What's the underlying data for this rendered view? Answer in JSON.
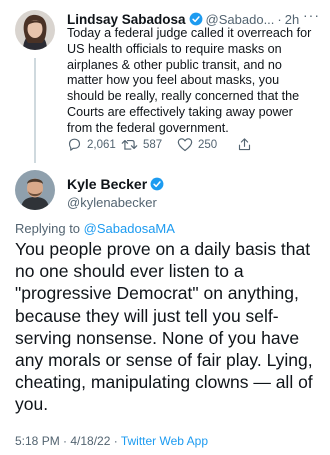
{
  "parent_tweet": {
    "display_name": "Lindsay Sabadosa",
    "handle": "@Sabado...",
    "separator": "·",
    "time": "2h",
    "more": "···",
    "text": "Today a federal judge called it overreach for US health officials to require masks on airplanes & other public transit, and no matter how you feel about masks, you should be really, really concerned that the Courts are effectively taking away power from the federal government.",
    "replies": "2,061",
    "retweets": "587",
    "likes": "250"
  },
  "main_tweet": {
    "display_name": "Kyle Becker",
    "handle": "@kylenabecker",
    "replying_prefix": "Replying to",
    "replying_to": "@SabadosaMA",
    "text": "You people prove on a daily basis that no one should ever listen to a \"progressive Democrat\" on anything, because they will just tell you self-serving nonsense. None of you have any morals or sense of fair play. Lying, cheating, manipulating clowns — all of you.",
    "timestamp": "5:18 PM · 4/18/22 · ",
    "source_app": "Twitter Web App"
  },
  "colors": {
    "accent": "#1d9bf0",
    "secondary_text": "#536471",
    "thread_line": "#cfd9de"
  },
  "icons": [
    "verified-badge-icon",
    "reply-icon",
    "retweet-icon",
    "like-icon",
    "share-icon"
  ]
}
